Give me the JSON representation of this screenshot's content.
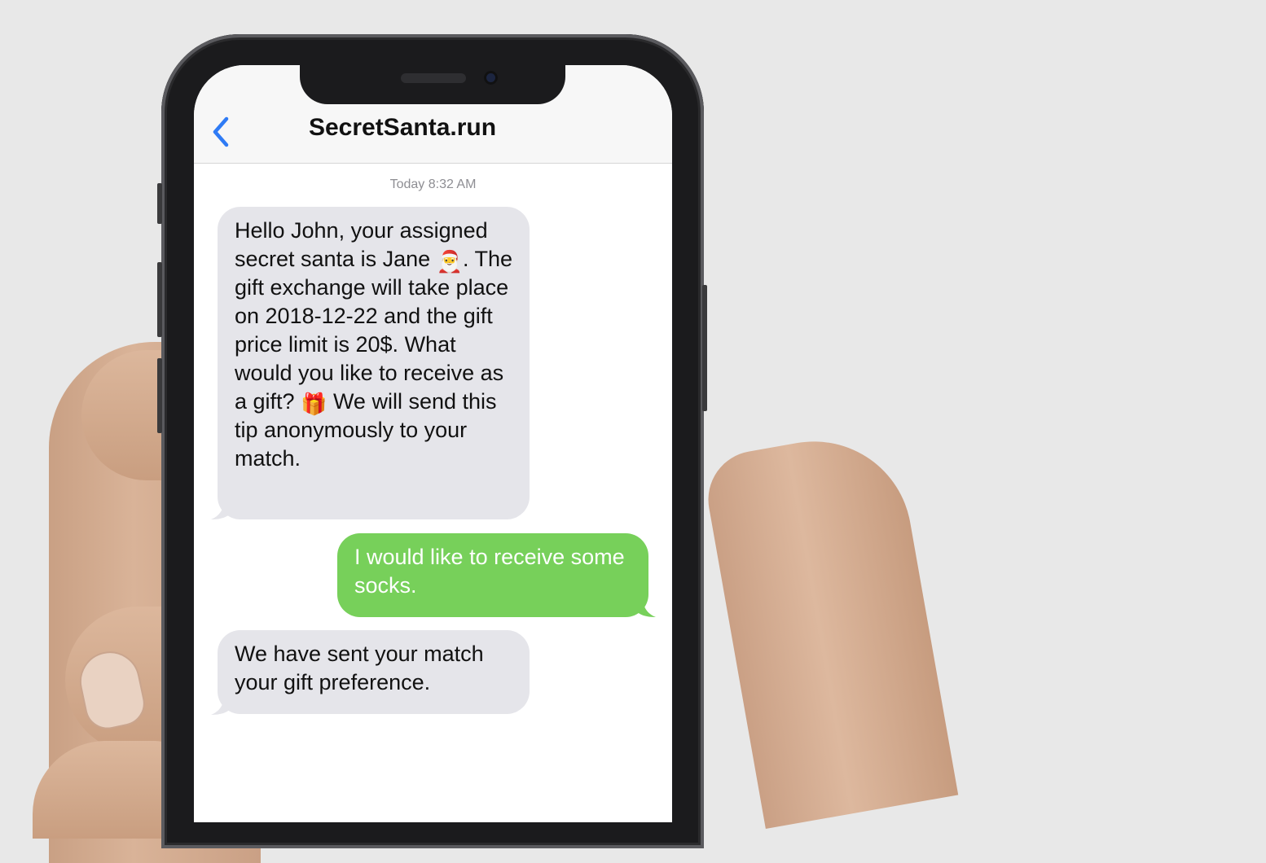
{
  "chat": {
    "contact_name": "SecretSanta.run",
    "back_icon": "chevron-left-icon",
    "timestamp": "Today 8:32 AM",
    "accent_color": "#2f7bf5",
    "incoming_color": "#e5e5ea",
    "outgoing_color": "#77d05a"
  },
  "messages": [
    {
      "direction": "incoming",
      "part1": "Hello John, your assigned secret santa is Jane ",
      "emoji1": "🎅",
      "part2": ". The gift exchange will take place on 2018-12-22 and the gift price limit is 20$. What would you like to receive as a gift? ",
      "emoji2": "🎁",
      "part3": " We will send this tip anonymously to your match."
    },
    {
      "direction": "outgoing",
      "text": "I would like to receive some socks."
    },
    {
      "direction": "incoming",
      "text": "We have sent your match your gift preference."
    }
  ]
}
